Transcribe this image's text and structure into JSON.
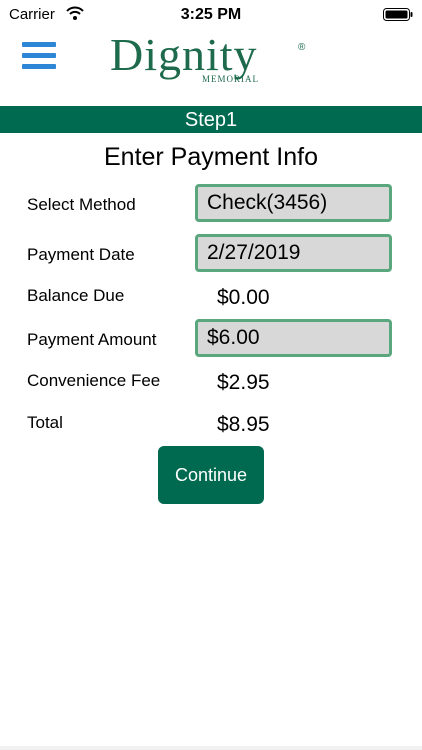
{
  "status_bar": {
    "carrier": "Carrier",
    "time": "3:25 PM"
  },
  "header": {
    "logo_word": "Dignity",
    "logo_sub": "MEMORIAL",
    "logo_reg": "®"
  },
  "step": {
    "label": "Step1"
  },
  "form": {
    "title": "Enter Payment Info",
    "select_method": {
      "label": "Select Method",
      "value": "Check(3456)"
    },
    "payment_date": {
      "label": "Payment Date",
      "value": "2/27/2019"
    },
    "balance_due": {
      "label": "Balance Due",
      "value": "$0.00"
    },
    "payment_amount": {
      "label": "Payment Amount",
      "value": "$6.00"
    },
    "convenience_fee": {
      "label": "Convenience Fee",
      "value": "$2.95"
    },
    "total": {
      "label": "Total",
      "value": "$8.95"
    },
    "continue_label": "Continue"
  },
  "colors": {
    "brand_green": "#006a50",
    "menu_blue": "#2e86d6",
    "field_border": "#5aa67d"
  },
  "icons": {
    "menu": "hamburger-menu-icon",
    "wifi": "wifi-icon",
    "battery": "battery-icon"
  }
}
